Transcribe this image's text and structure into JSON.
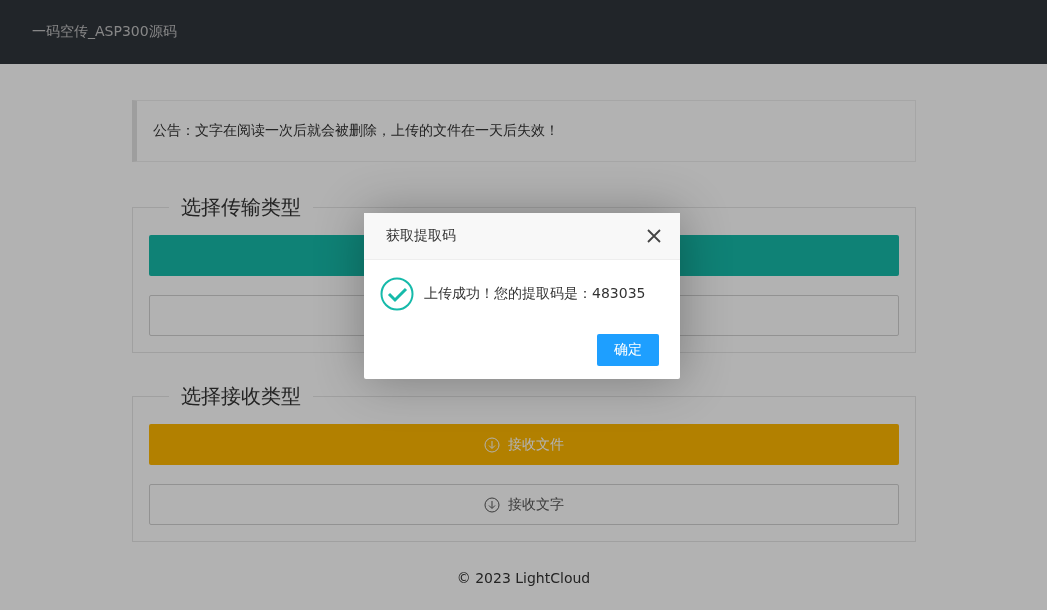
{
  "navbar": {
    "title": "一码空传_ASP300源码"
  },
  "notice": {
    "text": "公告：文字在阅读一次后就会被删除，上传的文件在一天后失效！"
  },
  "sections": [
    {
      "legend": "选择传输类型",
      "buttons": [
        {
          "kind": "primary"
        },
        {
          "kind": "outline"
        }
      ]
    },
    {
      "legend": "选择接收类型",
      "buttons": [
        {
          "kind": "warm",
          "label": "接收文件"
        },
        {
          "kind": "outline",
          "label": "接收文字"
        }
      ]
    }
  ],
  "footer": {
    "text": "© 2023 LightCloud"
  },
  "dialog": {
    "title": "获取提取码",
    "message": "上传成功！您的提取码是：483035",
    "button": "确定"
  }
}
